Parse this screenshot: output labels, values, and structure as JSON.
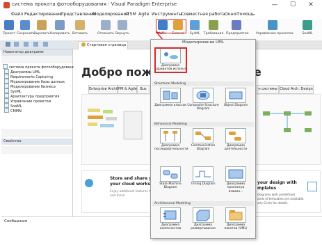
{
  "window": {
    "title": "система проката фотооборудования - Visual Paradigm Enterprise",
    "controls": {
      "minimize": "—",
      "maximize": "☐",
      "close": "✕"
    }
  },
  "menu": [
    "Файл",
    "Редактирование",
    "Представление",
    "Моделирование",
    "ITSM",
    "Agile",
    "Инструменты",
    "Совместная работа",
    "Окно",
    "Помощь"
  ],
  "toolbar": [
    {
      "label": "Проект",
      "color": "#4a7cc4"
    },
    {
      "label": "Сохранить",
      "color": "#5b8cd0"
    },
    {
      "label": "Вырезать",
      "color": "#c9a25a"
    },
    {
      "label": "Копировать",
      "color": "#7a9bc6"
    },
    {
      "label": "Вставить",
      "color": "#d4b06a"
    },
    {
      "label": "Отменить",
      "color": "#9ab0c9"
    },
    {
      "label": "Вернуть",
      "color": "#9ab0c9"
    },
    {
      "label": "UML",
      "color": "#3f7fc7"
    },
    {
      "label": "Бизнес",
      "color": "#e0a13a"
    },
    {
      "label": "SysML",
      "color": "#5f9fd6"
    },
    {
      "label": "Требования",
      "color": "#8aa04e"
    },
    {
      "label": "Предприятие",
      "color": "#6a7bc4"
    },
    {
      "label": "Управление проектом",
      "color": "#4a93c4"
    },
    {
      "label": "SoaML",
      "color": "#3b9c8a"
    }
  ],
  "tab": {
    "label": "Стартовая страница"
  },
  "left_panel": {
    "nav_title": "Навигатор диаграмм",
    "tree": [
      "система проката фотооборудования",
      "Диаграммы UML",
      "Requirements Capturing",
      "Моделирование базы данных",
      "Моделирование бизнеса",
      "SysML",
      "Архитектура предприятия",
      "Управление проектом",
      "SoaML",
      "CMMN"
    ],
    "props_title": "Свойства"
  },
  "main": {
    "welcome": "Добро пожаловат",
    "welcome_tail": "е",
    "sub_tabs": [
      "Enterprise Archit.",
      "PM & Agile",
      "Bus",
      "н системы",
      "Cloud Arch. Design"
    ],
    "store_title": "Store and share yo",
    "store_title2": "your cloud worksp",
    "store_desc": "Enjoy additional features th",
    "store_desc2": "and more.",
    "promo_title": "your design with",
    "promo_title2": "mplates",
    "promo_desc": "diagrams with predefined",
    "promo_desc2": "ands of templates are available.",
    "promo_desc3": "orly Circle for details."
  },
  "dropdown": {
    "title": "Моделирование UML",
    "selected": {
      "label": "Диаграмма вариантов использ"
    },
    "sections": [
      {
        "name": "Structural Modeling",
        "items": [
          "Диаграмма классов",
          "Composite Structure Diagram",
          "Object Diagram"
        ]
      },
      {
        "name": "Behavioral Modeling",
        "items": [
          "Диаграмма последовательности",
          "Communication Diagram",
          "Диаграмма деятельности"
        ]
      },
      {
        "name": "",
        "items": [
          "State Machine Diagram",
          "Timing Diagram",
          "Диаграмма просмотра взаимо..."
        ]
      },
      {
        "name": "Architectural Modeling",
        "items": [
          "Диаграмма компонентов",
          "Диаграмма развертывания",
          "Диаграмма пакетов (UML)"
        ]
      }
    ]
  },
  "output": {
    "title": "Сообщения"
  },
  "colors": {
    "accent": "#d32a2a",
    "panel_header": "#dfe6ee"
  }
}
